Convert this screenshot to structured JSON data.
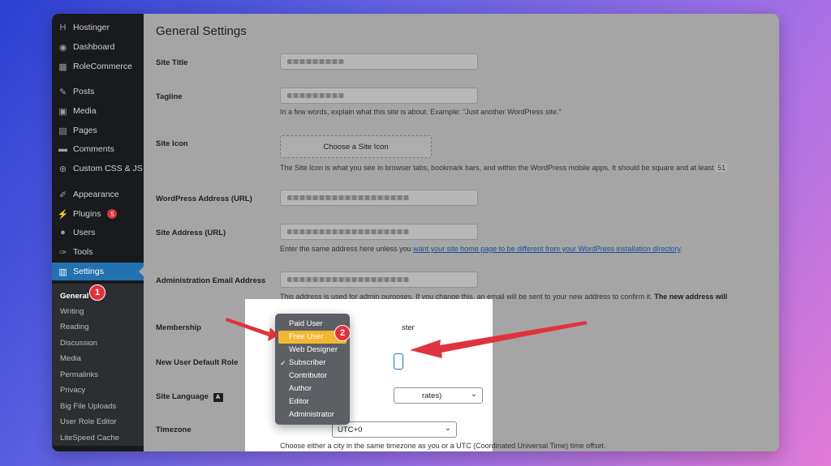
{
  "sidebar": {
    "items": [
      {
        "label": "Hostinger",
        "icon": "hostinger-icon",
        "glyph": "H"
      },
      {
        "label": "Dashboard",
        "icon": "dashboard-icon",
        "glyph": "◉"
      },
      {
        "label": "RoleCommerce",
        "icon": "store-icon",
        "glyph": "▦"
      },
      {
        "label": "Posts",
        "icon": "pin-icon",
        "glyph": "✎"
      },
      {
        "label": "Media",
        "icon": "media-icon",
        "glyph": "▣"
      },
      {
        "label": "Pages",
        "icon": "pages-icon",
        "glyph": "▤"
      },
      {
        "label": "Comments",
        "icon": "comments-icon",
        "glyph": "▬"
      },
      {
        "label": "Custom CSS & JS",
        "icon": "plus-circle-icon",
        "glyph": "⊕"
      },
      {
        "label": "Appearance",
        "icon": "brush-icon",
        "glyph": "✐"
      },
      {
        "label": "Plugins",
        "icon": "plugin-icon",
        "glyph": "⚡",
        "badge": "5"
      },
      {
        "label": "Users",
        "icon": "users-icon",
        "glyph": "●"
      },
      {
        "label": "Tools",
        "icon": "wrench-icon",
        "glyph": "✑"
      },
      {
        "label": "Settings",
        "icon": "settings-icon",
        "glyph": "▥"
      }
    ],
    "submenu": [
      "General",
      "Writing",
      "Reading",
      "Discussion",
      "Media",
      "Permalinks",
      "Privacy",
      "Big File Uploads",
      "User Role Editor",
      "LiteSpeed Cache"
    ]
  },
  "page": {
    "title": "General Settings",
    "labels": {
      "site_title": "Site Title",
      "tagline": "Tagline",
      "site_icon": "Site Icon",
      "wp_address": "WordPress Address (URL)",
      "site_address": "Site Address (URL)",
      "admin_email": "Administration Email Address",
      "membership": "Membership",
      "default_role": "New User Default Role",
      "site_language": "Site Language",
      "timezone": "Timezone"
    },
    "tagline_desc": "In a few words, explain what this site is about. Example: “Just another WordPress site.”",
    "site_icon_button": "Choose a Site Icon",
    "site_icon_desc": "The Site Icon is what you see in browser tabs, bookmark bars, and within the WordPress mobile apps. It should be square and at least",
    "site_icon_desc_tail": "51",
    "site_address_desc_pre": "Enter the same address here unless you ",
    "site_address_link": "want your site home page to be different from your WordPress installation directory",
    "site_address_desc_post": ".",
    "admin_email_desc": "This address is used for admin purposes. If you change this, an email will be sent to your new address to confirm it.",
    "admin_email_desc_bold": "The new address will",
    "membership_tail": "ster",
    "language_value": "rates)",
    "timezone_value": "UTC+0",
    "timezone_desc": "Choose either a city in the same timezone as you or a UTC (Coordinated Universal Time) time offset."
  },
  "role_dropdown": {
    "options": [
      "Paid User",
      "Free User",
      "Web Designer",
      "Subscriber",
      "Contributor",
      "Author",
      "Editor",
      "Administrator"
    ],
    "highlighted": "Free User",
    "checked": "Subscriber",
    "highlight_color": "#f2b731"
  },
  "annotations": {
    "step1": "1",
    "step2": "2",
    "arrow_color": "#e0323c"
  }
}
